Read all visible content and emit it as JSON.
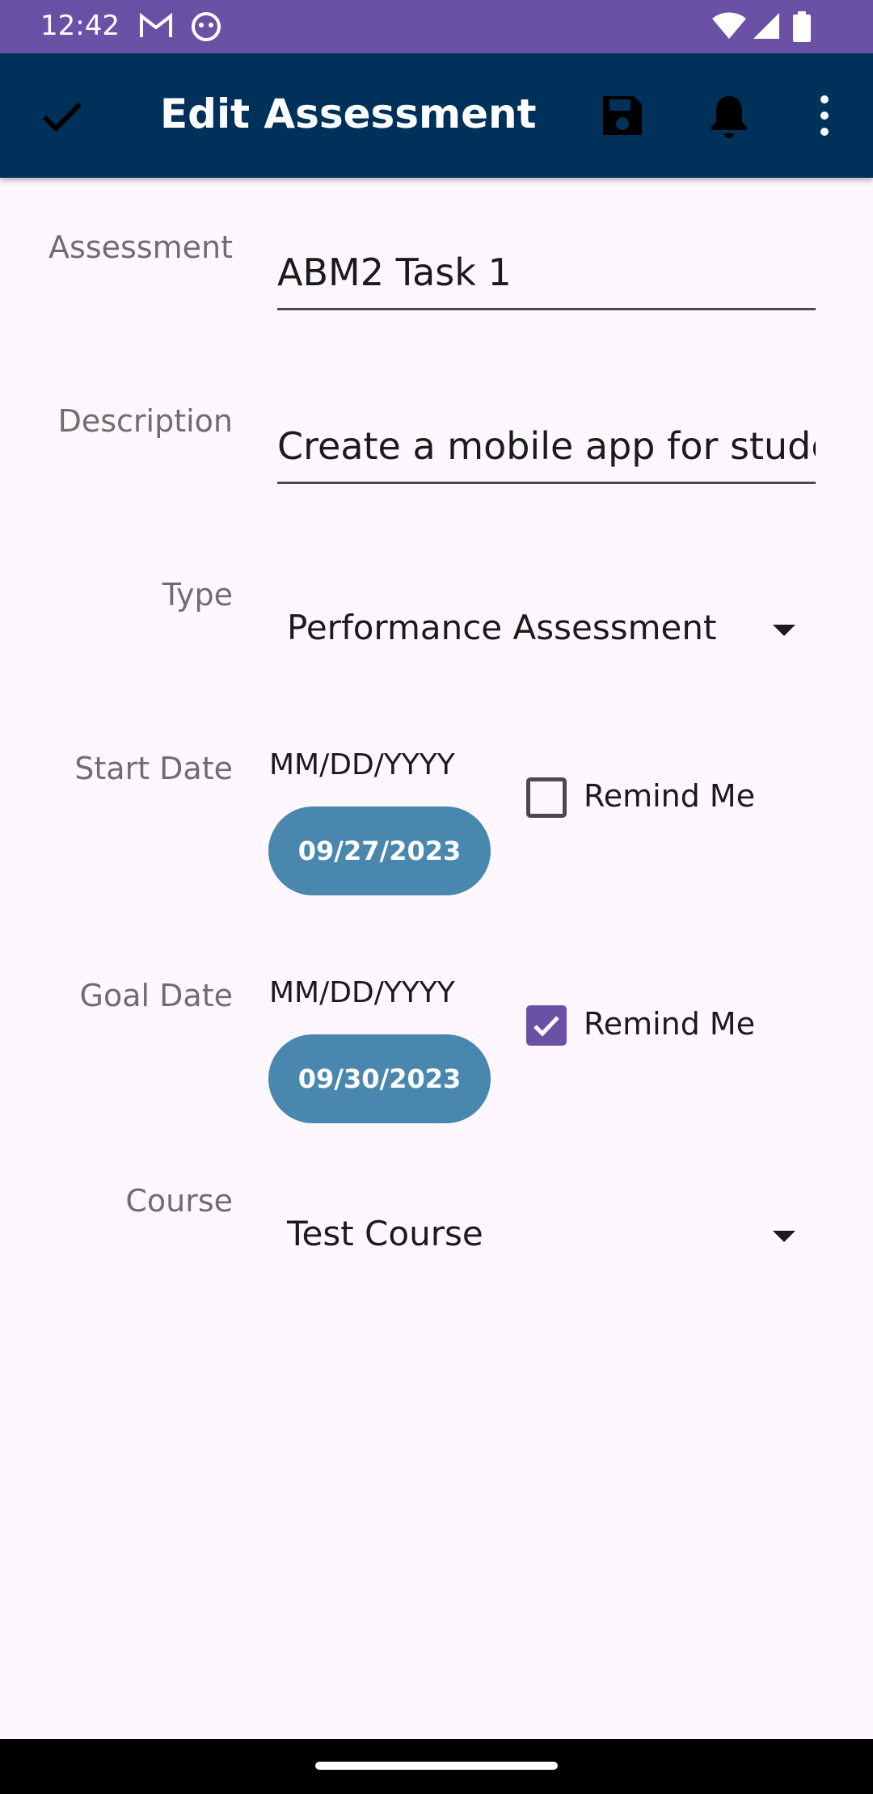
{
  "status_bar": {
    "time": "12:42",
    "icons": [
      "gmail-icon",
      "app-notification-icon",
      "wifi-icon",
      "signal-icon",
      "battery-icon"
    ]
  },
  "app_bar": {
    "title": "Edit Assessment",
    "icons": [
      "check-icon",
      "save-icon",
      "bell-icon",
      "more-vert-icon"
    ]
  },
  "form": {
    "assessment": {
      "label": "Assessment",
      "value": "ABM2 Task 1"
    },
    "description": {
      "label": "Description",
      "value": "Create a mobile app for students"
    },
    "type": {
      "label": "Type",
      "value": "Performance Assessment"
    },
    "start_date": {
      "label": "Start Date",
      "hint": "MM/DD/YYYY",
      "value": "09/27/2023",
      "remind_label": "Remind Me",
      "remind_checked": false
    },
    "goal_date": {
      "label": "Goal Date",
      "hint": "MM/DD/YYYY",
      "value": "09/30/2023",
      "remind_label": "Remind Me",
      "remind_checked": true
    },
    "course": {
      "label": "Course",
      "value": "Test Course"
    }
  },
  "colors": {
    "status_bar": "#6A51A6",
    "app_bar": "#00315B",
    "date_button": "#4A87AE",
    "checkbox_checked": "#6A51A6",
    "background": "#FEF7FF"
  }
}
